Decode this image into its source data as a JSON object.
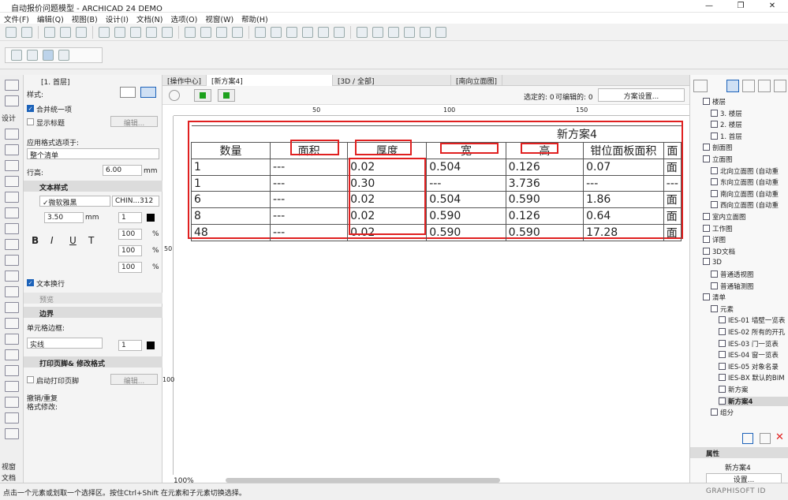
{
  "window": {
    "title": "自动报价问题模型 - ARCHICAD 24 DEMO"
  },
  "menu": [
    "文件(F)",
    "编辑(Q)",
    "视图(B)",
    "设计(I)",
    "文档(N)",
    "选项(O)",
    "视窗(W)",
    "帮助(H)"
  ],
  "panel": {
    "story": "[1. 首层]",
    "style_label": "样式:",
    "merge_label": "合并统一项",
    "show_title_label": "显示标题",
    "edit_label": "编辑...",
    "apply_label": "应用格式选项于:",
    "apply_value": "整个清单",
    "row_height_label": "行高:",
    "row_height_value": "6.00",
    "mm": "mm",
    "text_style_header": "文本样式",
    "font_value": "✓微软雅黑",
    "encoding_value": "CHIN...312",
    "size_value": "3.50",
    "pen_value": "1",
    "pct1": "100",
    "pct2": "100",
    "pct3": "100",
    "pct": "%",
    "wrap_label": "文本换行",
    "preview_label": "预览",
    "border_header": "边界",
    "cell_border_label": "单元格边框:",
    "line_value": "实线",
    "line_pen": "1",
    "print_header": "打印页脚& 修改格式",
    "enable_footer_label": "启动打印页脚",
    "edit2_label": "编辑...",
    "undo_label": "撤销/重复",
    "format_label": "格式修改:",
    "design_label": "设计",
    "view_label": "视窗",
    "doc_label": "文档"
  },
  "tabs": [
    "[操作中心]",
    "[新方案4]",
    "[3D / 全部]",
    "[南向立面图]"
  ],
  "doc": {
    "selected": "选定的: 0",
    "editable": "可编辑的: 0",
    "scheme_settings": "方案设置...",
    "ruler_50": "50",
    "ruler_100": "100",
    "ruler_150": "150",
    "vruler_50": "50",
    "vruler_100": "100",
    "zoom": "100%"
  },
  "schedule": {
    "title": "新方案4",
    "headers": [
      "数量",
      "面积",
      "厚度",
      "宽",
      "高",
      "钳位面板面积",
      "面"
    ],
    "rows": [
      [
        "1",
        "---",
        "0.02",
        "0.504",
        "0.126",
        "0.07",
        "面"
      ],
      [
        "1",
        "---",
        "0.30",
        "---",
        "3.736",
        "---",
        "---"
      ],
      [
        "6",
        "---",
        "0.02",
        "0.504",
        "0.590",
        "1.86",
        "面"
      ],
      [
        "8",
        "---",
        "0.02",
        "0.590",
        "0.126",
        "0.64",
        "面"
      ],
      [
        "48",
        "---",
        "0.02",
        "0.590",
        "0.590",
        "17.28",
        "面"
      ]
    ]
  },
  "tree": [
    {
      "label": "楼层",
      "level": 1
    },
    {
      "label": "3. 楼层",
      "level": 2
    },
    {
      "label": "2. 楼层",
      "level": 2
    },
    {
      "label": "1. 首层",
      "level": 2
    },
    {
      "label": "剖面图",
      "level": 1
    },
    {
      "label": "立面图",
      "level": 1
    },
    {
      "label": "北向立面图 (自动重",
      "level": 2
    },
    {
      "label": "东向立面图 (自动重",
      "level": 2
    },
    {
      "label": "南向立面图 (自动重",
      "level": 2
    },
    {
      "label": "西向立面图 (自动重",
      "level": 2
    },
    {
      "label": "室内立面图",
      "level": 1
    },
    {
      "label": "工作图",
      "level": 1
    },
    {
      "label": "详图",
      "level": 1
    },
    {
      "label": "3D文档",
      "level": 1
    },
    {
      "label": "3D",
      "level": 1
    },
    {
      "label": "普通透视图",
      "level": 2
    },
    {
      "label": "普通轴测图",
      "level": 2
    },
    {
      "label": "清单",
      "level": 1
    },
    {
      "label": "元素",
      "level": 2
    },
    {
      "label": "IES-01 墙壁一览表",
      "level": 3
    },
    {
      "label": "IES-02 所有的开孔",
      "level": 3
    },
    {
      "label": "IES-03 门一览表",
      "level": 3
    },
    {
      "label": "IES-04 窗一览表",
      "level": 3
    },
    {
      "label": "IES-05 对象名录",
      "level": 3
    },
    {
      "label": "IES-BX 默认的BIM",
      "level": 3
    },
    {
      "label": "新方案",
      "level": 3
    },
    {
      "label": "新方案4",
      "level": 3
    },
    {
      "label": "组分",
      "level": 2
    }
  ],
  "properties": {
    "header": "属性",
    "value": "新方案4",
    "settings": "设置..."
  },
  "status": {
    "hint": "点击一个元素或划取一个选择区。按住Ctrl+Shift 在元素和子元素切换选择。",
    "brand": "GRAPHISOFT ID"
  }
}
